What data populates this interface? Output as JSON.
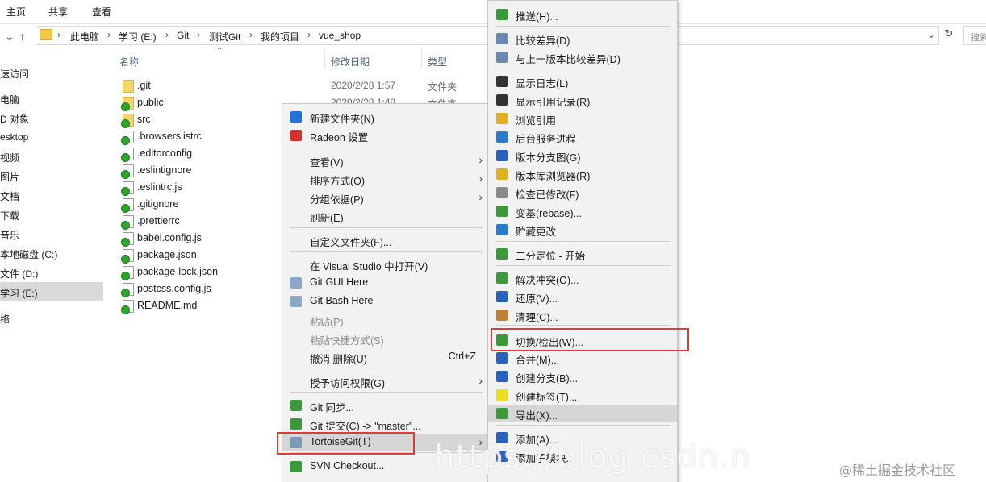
{
  "ribbon": {
    "tabs": [
      "主页",
      "共享",
      "查看"
    ]
  },
  "address": {
    "crumbs": [
      "此电脑",
      "学习 (E:)",
      "Git",
      "测试Git",
      "我的项目",
      "vue_shop"
    ],
    "search_placeholder": "搜索"
  },
  "nav_pane": {
    "items": [
      "速访问",
      "电脑",
      "D 对象",
      "esktop",
      "视频",
      "图片",
      "文档",
      "下载",
      "音乐",
      "本地磁盘 (C:)",
      "文件 (D:)",
      "学习 (E:)",
      "络"
    ],
    "selected_index": 11
  },
  "file_list": {
    "columns": [
      "名称",
      "修改日期",
      "类型"
    ],
    "files": [
      {
        "name": ".git",
        "date": "2020/2/28 1:57",
        "type": "文件夹",
        "kind": "folder"
      },
      {
        "name": "public",
        "date": "2020/2/28 1:48",
        "type": "文件夹",
        "kind": "folder-ok"
      },
      {
        "name": "src",
        "date": "",
        "type": "",
        "kind": "folder-ok"
      },
      {
        "name": ".browserslistrc",
        "date": "",
        "type": "",
        "kind": "file-ok"
      },
      {
        "name": ".editorconfig",
        "date": "",
        "type": "",
        "kind": "file-ok"
      },
      {
        "name": ".eslintignore",
        "date": "",
        "type": "",
        "kind": "file-ok"
      },
      {
        "name": ".eslintrc.js",
        "date": "",
        "type": "",
        "kind": "file-ok"
      },
      {
        "name": ".gitignore",
        "date": "",
        "type": "",
        "kind": "file-ok"
      },
      {
        "name": ".prettierrc",
        "date": "",
        "type": "",
        "kind": "file-ok"
      },
      {
        "name": "babel.config.js",
        "date": "",
        "type": "",
        "kind": "file-ok"
      },
      {
        "name": "package.json",
        "date": "",
        "type": "",
        "kind": "file-ok"
      },
      {
        "name": "package-lock.json",
        "date": "",
        "type": "",
        "kind": "file-ok"
      },
      {
        "name": "postcss.config.js",
        "date": "",
        "type": "",
        "kind": "file-ok"
      },
      {
        "name": "README.md",
        "date": "",
        "type": "",
        "kind": "file-ok"
      }
    ]
  },
  "context_menu": {
    "items": [
      {
        "label": "新建文件夹(N)",
        "icon": "new-folder-icon",
        "color": "#1e73d8"
      },
      {
        "label": "Radeon 设置",
        "icon": "radeon-icon",
        "color": "#d32f2f"
      },
      {
        "label": "查看(V)",
        "submenu": true
      },
      {
        "label": "排序方式(O)",
        "submenu": true
      },
      {
        "label": "分组依据(P)",
        "submenu": true
      },
      {
        "label": "刷新(E)"
      },
      {
        "label": "自定义文件夹(F)..."
      },
      {
        "label": "在 Visual Studio 中打开(V)"
      },
      {
        "label": "Git GUI Here",
        "icon": "git-gui-icon",
        "color": "#8aa8c8"
      },
      {
        "label": "Git Bash Here",
        "icon": "git-bash-icon",
        "color": "#8aa8c8"
      },
      {
        "label": "粘贴(P)",
        "disabled": true
      },
      {
        "label": "粘贴快捷方式(S)",
        "disabled": true
      },
      {
        "label": "撤消 删除(U)",
        "shortcut": "Ctrl+Z"
      },
      {
        "label": "授予访问权限(G)",
        "submenu": true
      },
      {
        "label": "Git 同步...",
        "icon": "git-sync-icon",
        "color": "#3a9a3a"
      },
      {
        "label": "Git 提交(C) -> \"master\"...",
        "icon": "git-commit-icon",
        "color": "#3a9a3a"
      },
      {
        "label": "TortoiseGit(T)",
        "icon": "tortoisegit-icon",
        "color": "#7a9ab8",
        "submenu": true
      },
      {
        "label": "SVN Checkout...",
        "icon": "svn-checkout-icon",
        "color": "#3a9a3a"
      }
    ]
  },
  "tortoise_menu": {
    "items": [
      {
        "label": "推送(H)...",
        "icon": "push-icon",
        "color": "#3a9a3a"
      },
      {
        "label": "比较差异(D)",
        "icon": "diff-icon",
        "color": "#6a8bb0"
      },
      {
        "label": "与上一版本比较差异(D)",
        "icon": "diff-prev-icon",
        "color": "#6a8bb0"
      },
      {
        "label": "显示日志(L)",
        "icon": "log-icon",
        "color": "#333333"
      },
      {
        "label": "显示引用记录(R)",
        "icon": "reflog-icon",
        "color": "#333333"
      },
      {
        "label": "浏览引用",
        "icon": "browse-refs-icon",
        "color": "#e0b020"
      },
      {
        "label": "后台服务进程",
        "icon": "daemon-icon",
        "color": "#2a7ad0"
      },
      {
        "label": "版本分支图(G)",
        "icon": "revision-graph-icon",
        "color": "#2a60c0"
      },
      {
        "label": "版本库浏览器(R)",
        "icon": "repo-browser-icon",
        "color": "#e0b020"
      },
      {
        "label": "检查已修改(F)",
        "icon": "check-modifications-icon",
        "color": "#8a8a8a"
      },
      {
        "label": "变基(rebase)...",
        "icon": "rebase-icon",
        "color": "#3a9a3a"
      },
      {
        "label": "贮藏更改",
        "icon": "stash-icon",
        "color": "#2a7ad0"
      },
      {
        "label": "二分定位 - 开始",
        "icon": "bisect-icon",
        "color": "#3a9a3a"
      },
      {
        "label": "解决冲突(O)...",
        "icon": "resolve-icon",
        "color": "#3a9a3a"
      },
      {
        "label": "还原(V)...",
        "icon": "revert-icon",
        "color": "#2a60c0"
      },
      {
        "label": "清理(C)...",
        "icon": "cleanup-icon",
        "color": "#c08030"
      },
      {
        "label": "切换/检出(W)...",
        "icon": "switch-checkout-icon",
        "color": "#3a9a3a"
      },
      {
        "label": "合并(M)...",
        "icon": "merge-icon",
        "color": "#2a60c0"
      },
      {
        "label": "创建分支(B)...",
        "icon": "create-branch-icon",
        "color": "#2a60c0"
      },
      {
        "label": "创建标签(T)...",
        "icon": "create-tag-icon",
        "color": "#e8e020"
      },
      {
        "label": "导出(X)...",
        "icon": "export-icon",
        "color": "#3a9a3a"
      },
      {
        "label": "添加(A)...",
        "icon": "add-icon",
        "color": "#2a60c0"
      },
      {
        "label": "添加子模块...",
        "icon": "add-submodule-icon",
        "color": "#2a60c0"
      }
    ]
  },
  "watermark": {
    "text": "https://blog.csdn.n",
    "corner": "@稀土掘金技术社区"
  }
}
